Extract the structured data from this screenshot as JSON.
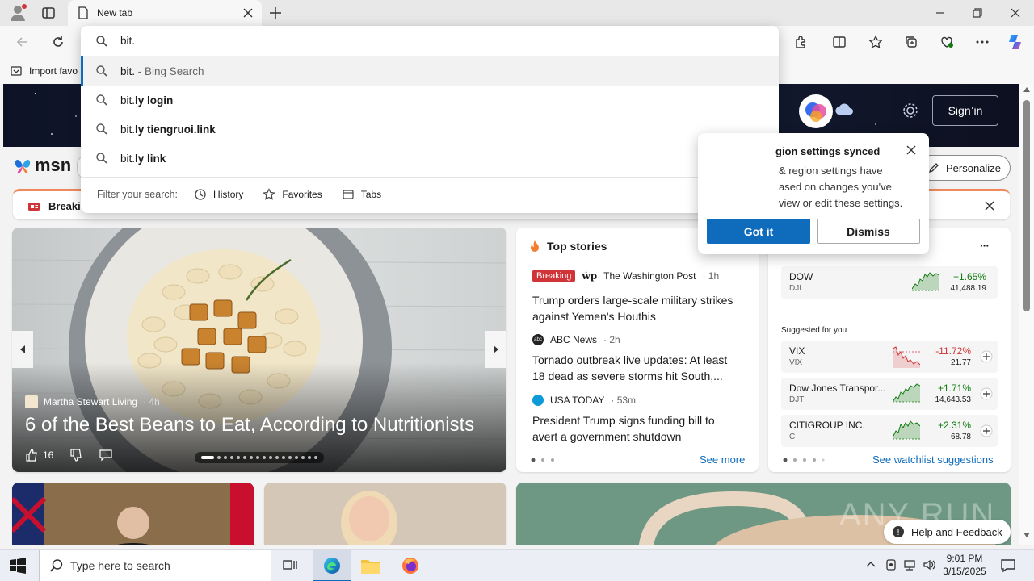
{
  "browser": {
    "tab_title": "New tab",
    "address_value": "bit.",
    "favorites_bar_item": "Import favo"
  },
  "suggestions": {
    "items": [
      {
        "prefix": "bit.",
        "bold": "",
        "source": " - Bing Search"
      },
      {
        "prefix": "bit.",
        "bold": "ly login",
        "source": ""
      },
      {
        "prefix": "bit.",
        "bold": "ly tiengruoi.link",
        "source": ""
      },
      {
        "prefix": "bit.",
        "bold": "ly link",
        "source": ""
      }
    ],
    "filter_label": "Filter your search:",
    "filters": [
      "History",
      "Favorites",
      "Tabs"
    ]
  },
  "msn": {
    "logo": "msn",
    "sign_in": "Sign in",
    "personalize": "Personalize",
    "breaking_label": "Breaki"
  },
  "popup": {
    "title": "gion settings synced",
    "body_lines": [
      "& region settings have",
      "ased on changes you've",
      "view or edit these settings."
    ],
    "got_it": "Got it",
    "dismiss": "Dismiss"
  },
  "hero": {
    "source": "Martha Stewart Living",
    "age": "· 4h",
    "title": "6 of the Best Beans to Eat, According to Nutritionists",
    "likes": "16"
  },
  "top_stories": {
    "heading": "Top stories",
    "stories": [
      {
        "badge": "Breaking",
        "logo": "wp",
        "source": "The Washington Post",
        "age": "· 1h",
        "headline_1": "Trump orders large-scale military strikes",
        "headline_2": "against Yemen's Houthis"
      },
      {
        "badge": "",
        "logo": "abc",
        "source": "ABC News",
        "age": "· 2h",
        "headline_1": "Tornado outbreak live updates: At least",
        "headline_2": "18 dead as severe storms hit South,..."
      },
      {
        "badge": "",
        "logo": "usa",
        "source": "USA TODAY",
        "age": "· 53m",
        "headline_1": "President Trump signs funding bill to",
        "headline_2": "avert a government shutdown"
      }
    ],
    "see_more": "See more"
  },
  "watchlist": {
    "more": "···",
    "main": {
      "name": "DOW",
      "ticker": "DJI",
      "change": "+1.65%",
      "price": "41,488.19"
    },
    "suggested_label": "Suggested for you",
    "suggested": [
      {
        "name": "VIX",
        "ticker": "VIX",
        "change": "-11.72%",
        "price": "21.77",
        "color": "#d13438"
      },
      {
        "name": "Dow Jones Transpor...",
        "ticker": "DJT",
        "change": "+1.71%",
        "price": "14,643.53",
        "color": "#107c10"
      },
      {
        "name": "CITIGROUP INC.",
        "ticker": "C",
        "change": "+2.31%",
        "price": "68.78",
        "color": "#107c10"
      }
    ],
    "see_suggestions": "See watchlist suggestions"
  },
  "footer": {
    "help": "Help and Feedback",
    "watermark": "ANY RUN"
  },
  "taskbar": {
    "search_placeholder": "Type here to search",
    "time": "9:01 PM",
    "date": "3/15/2025"
  }
}
